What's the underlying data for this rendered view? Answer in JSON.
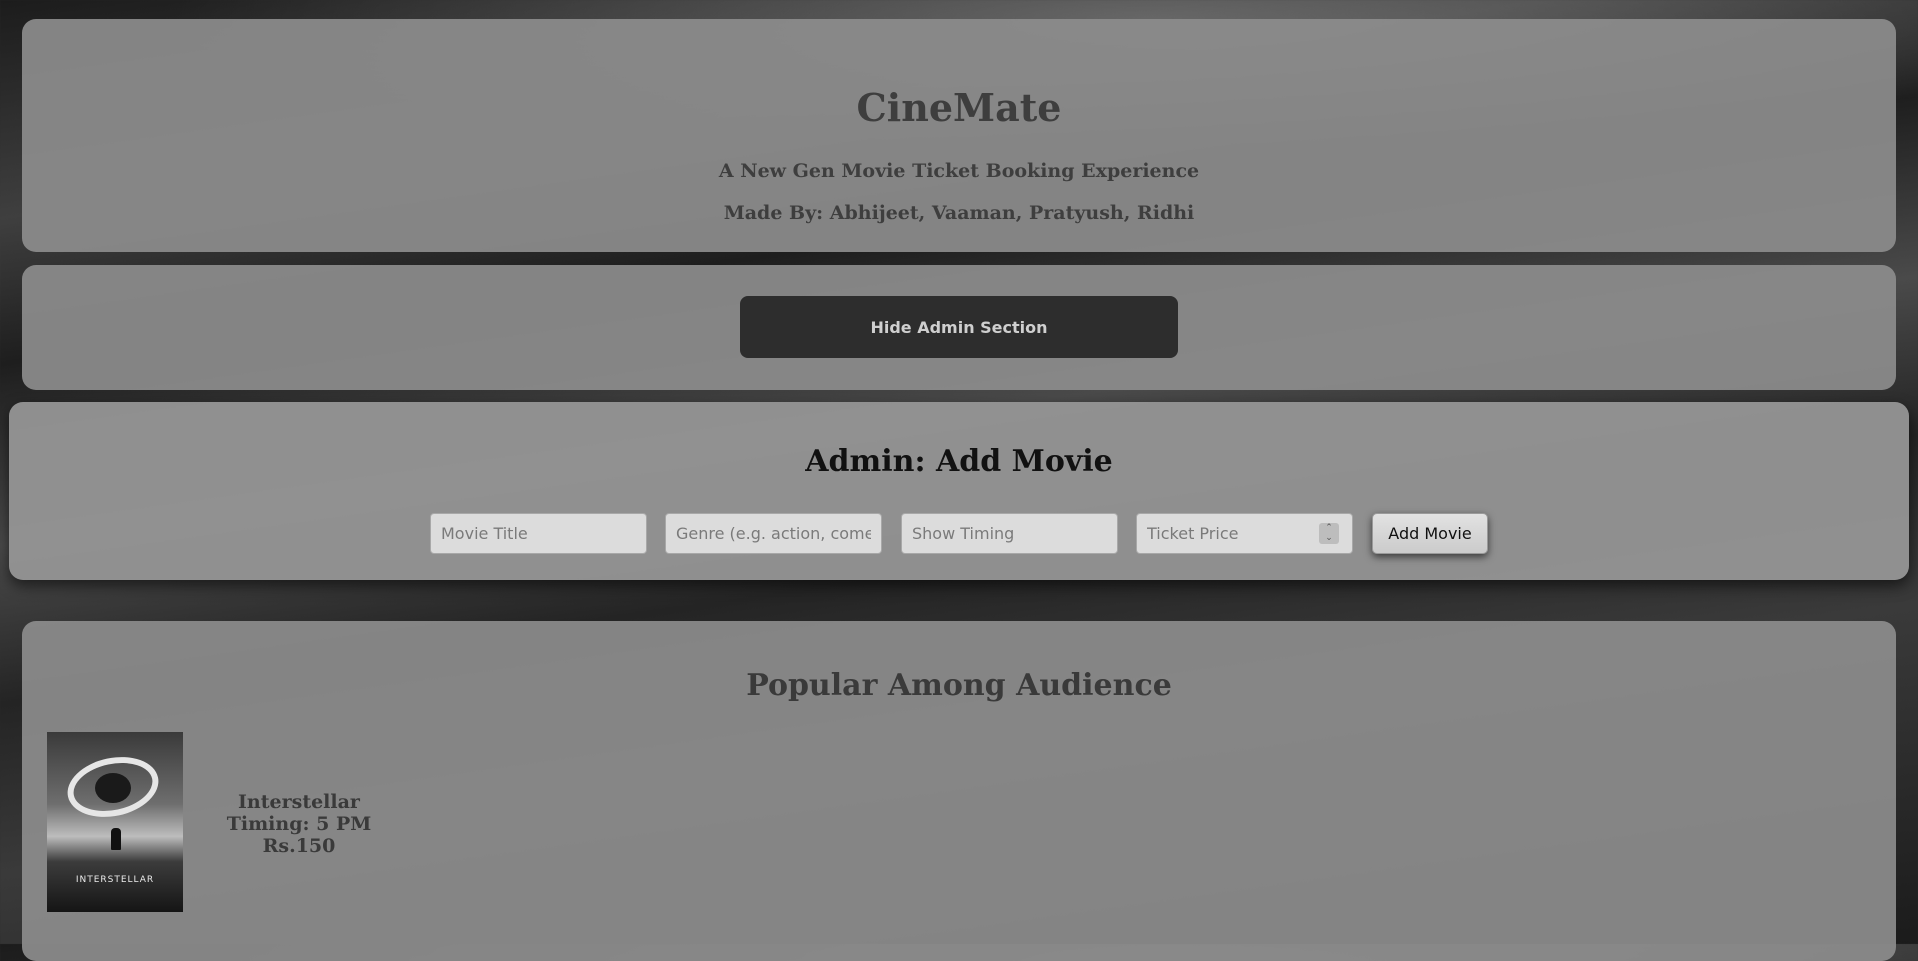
{
  "header": {
    "title": "CineMate",
    "tagline": "A New Gen Movie Ticket Booking Experience",
    "credits": "Made By: Abhijeet, Vaaman, Pratyush, Ridhi"
  },
  "admin_toggle": {
    "label": "Hide Admin Section"
  },
  "admin": {
    "title": "Admin: Add Movie",
    "fields": {
      "title_placeholder": "Movie Title",
      "genre_placeholder": "Genre (e.g. action, comedy",
      "timing_placeholder": "Show Timing",
      "price_placeholder": "Ticket Price"
    },
    "add_button": "Add Movie"
  },
  "popular": {
    "title": "Popular Among Audience",
    "movies": [
      {
        "name": "Interstellar",
        "timing": "Timing: 5 PM",
        "price": "Rs.150",
        "poster_text": "INTERSTELLAR"
      }
    ]
  },
  "colors": {
    "panel": "#8c8c8c",
    "dark_button": "#2d2d2d",
    "heading_text": "#3e3e3e"
  }
}
